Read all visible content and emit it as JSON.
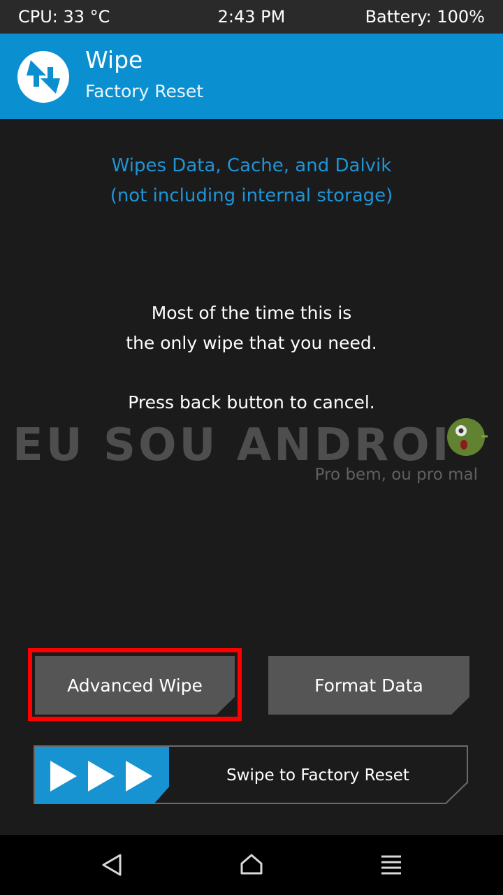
{
  "status": {
    "cpu": "CPU: 33 °C",
    "time": "2:43 PM",
    "battery": "Battery: 100%"
  },
  "header": {
    "title": "Wipe",
    "subtitle": "Factory Reset",
    "logo_icon": "twrp-logo-icon"
  },
  "info": {
    "line1": "Wipes Data, Cache, and Dalvik",
    "line2": "(not including internal storage)",
    "msg1": "Most of the time this is",
    "msg2": "the only wipe that you need.",
    "msg3": "Press back button to cancel."
  },
  "watermark": {
    "title": "EU SOU ANDROI",
    "tagline": "Pro bem, ou pro mal"
  },
  "buttons": {
    "advanced_wipe": "Advanced Wipe",
    "format_data": "Format Data"
  },
  "swipe": {
    "label": "Swipe to Factory Reset"
  },
  "colors": {
    "accent": "#0a8fd0",
    "info_text": "#1f94d6",
    "highlight": "#ff0000",
    "button": "#555555",
    "background": "#1b1b1b"
  },
  "nav": {
    "back_icon": "back-triangle-icon",
    "home_icon": "home-icon",
    "menu_icon": "menu-lines-icon"
  }
}
